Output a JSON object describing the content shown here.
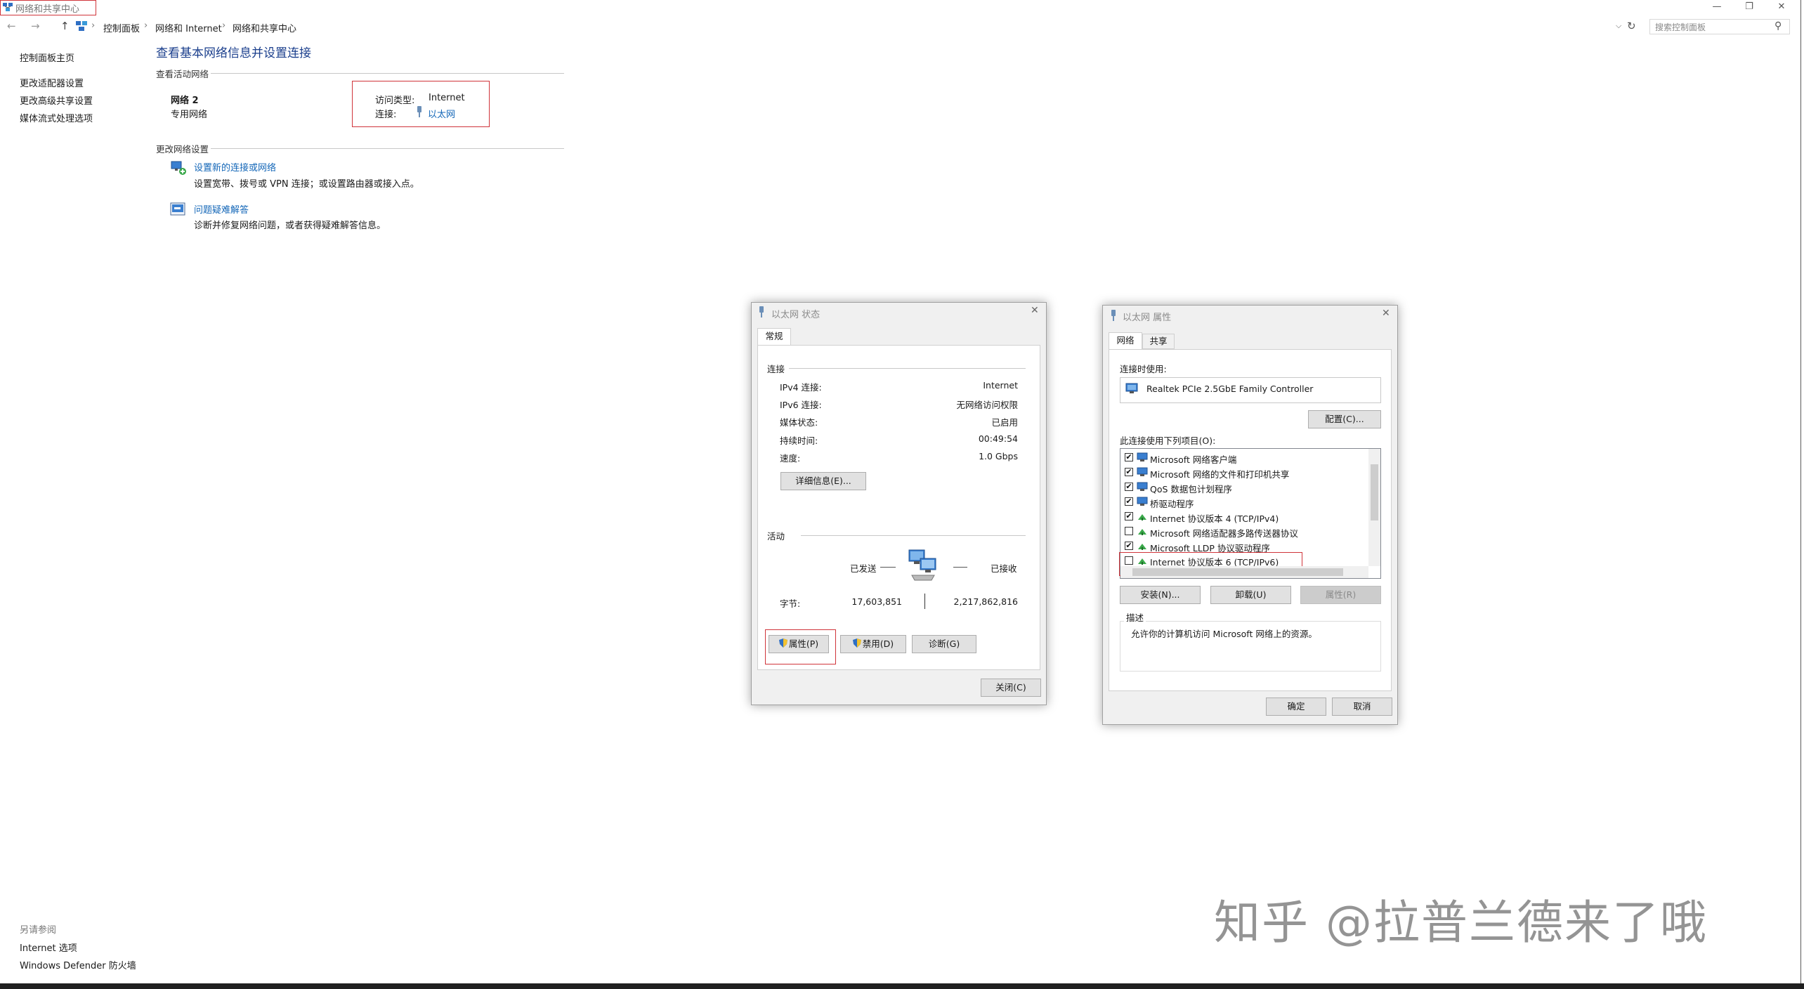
{
  "window": {
    "title": "网络和共享中心",
    "min_glyph": "—",
    "max_glyph": "❐",
    "close_glyph": "✕"
  },
  "address": {
    "crumbs": [
      "控制面板",
      "网络和 Internet",
      "网络和共享中心"
    ],
    "sep": "›",
    "back": "←",
    "forward": "→",
    "up": "↑",
    "dropdown": "⌵",
    "refresh": "↻",
    "search_placeholder": "搜索控制面板",
    "search_glyph": "⚲"
  },
  "sidebar": {
    "home": "控制面板主页",
    "links": [
      "更改适配器设置",
      "更改高级共享设置",
      "媒体流式处理选项"
    ],
    "see_also_title": "另请参阅",
    "see_also": [
      "Internet 选项",
      "Windows Defender 防火墙"
    ]
  },
  "main": {
    "title": "查看基本网络信息并设置连接",
    "active_header": "查看活动网络",
    "network_name": "网络 2",
    "network_type": "专用网络",
    "access_label": "访问类型:",
    "access_value": "Internet",
    "conn_label": "连接:",
    "conn_value": "以太网",
    "change_header": "更改网络设置",
    "task1_title": "设置新的连接或网络",
    "task1_desc": "设置宽带、拨号或 VPN 连接；或设置路由器或接入点。",
    "task2_title": "问题疑难解答",
    "task2_desc": "诊断并修复网络问题，或者获得疑难解答信息。"
  },
  "status_dialog": {
    "title": "以太网 状态",
    "tab": "常规",
    "group_conn": "连接",
    "rows": [
      {
        "label": "IPv4 连接:",
        "value": "Internet"
      },
      {
        "label": "IPv6 连接:",
        "value": "无网络访问权限"
      },
      {
        "label": "媒体状态:",
        "value": "已启用"
      },
      {
        "label": "持续时间:",
        "value": "00:49:54"
      },
      {
        "label": "速度:",
        "value": "1.0 Gbps"
      }
    ],
    "details_btn": "详细信息(E)...",
    "group_activity": "活动",
    "sent_label": "已发送",
    "recv_label": "已接收",
    "bytes_label": "字节:",
    "bytes_sent": "17,603,851",
    "bytes_recv": "2,217,862,816",
    "props_btn": "属性(P)",
    "disable_btn": "禁用(D)",
    "diagnose_btn": "诊断(G)",
    "close_btn": "关闭(C)"
  },
  "props_dialog": {
    "title": "以太网 属性",
    "tabs": [
      "网络",
      "共享"
    ],
    "connect_using": "连接时使用:",
    "adapter": "Realtek PCIe 2.5GbE Family Controller",
    "configure_btn": "配置(C)...",
    "items_label": "此连接使用下列项目(O):",
    "items": [
      {
        "text": "Microsoft 网络客户端",
        "checked": "✔",
        "icon": "network-client-icon"
      },
      {
        "text": "Microsoft 网络的文件和打印机共享",
        "checked": "✔",
        "icon": "file-share-icon"
      },
      {
        "text": "QoS 数据包计划程序",
        "checked": "✔",
        "icon": "qos-icon"
      },
      {
        "text": "桥驱动程序",
        "checked": "✔",
        "icon": "bridge-icon"
      },
      {
        "text": "Internet 协议版本 4 (TCP/IPv4)",
        "checked": "✔",
        "icon": "protocol-icon"
      },
      {
        "text": "Microsoft 网络适配器多路传送器协议",
        "checked": "",
        "icon": "protocol-icon"
      },
      {
        "text": "Microsoft LLDP 协议驱动程序",
        "checked": "✔",
        "icon": "protocol-icon"
      },
      {
        "text": "Internet 协议版本 6 (TCP/IPv6)",
        "checked": "",
        "icon": "protocol-icon"
      }
    ],
    "install_btn": "安装(N)...",
    "uninstall_btn": "卸载(U)",
    "properties_btn": "属性(R)",
    "desc_label": "描述",
    "desc_text": "允许你的计算机访问 Microsoft 网络上的资源。",
    "ok_btn": "确定",
    "cancel_btn": "取消"
  },
  "watermark": "知乎 @拉普兰德来了哦",
  "colors": {
    "link": "#1467b8",
    "heading": "#1a3e8c",
    "highlight": "#d0343a"
  }
}
